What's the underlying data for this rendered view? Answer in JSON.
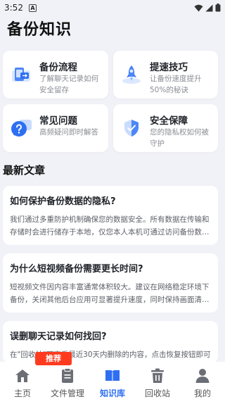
{
  "status": {
    "time": "3:52",
    "notification_icon": "A"
  },
  "page_title": "备份知识",
  "cards": [
    {
      "title": "备份流程",
      "desc": "了解聊天记录如何安全留存",
      "icon": "phone-backup-icon"
    },
    {
      "title": "提速技巧",
      "desc": "让备份速度提升50%的秘诀",
      "icon": "rocket-icon"
    },
    {
      "title": "常见问题",
      "desc": "高频疑问即时解答",
      "icon": "question-bubble-icon"
    },
    {
      "title": "安全保障",
      "desc": "您的隐私权如何被守护",
      "icon": "shield-icon"
    }
  ],
  "section_title": "最新文章",
  "articles": [
    {
      "title": "如何保护备份数据的隐私?",
      "body": "我们通过多重防护机制确保您的数据安全。所有数据在传输和存储时会进行储存于本地，仅您本人本机可通过访问备份数据。"
    },
    {
      "title": "为什么短视频备份需要更长时间?",
      "body": "短视频文件因内容丰富通常体积较大。建议在网络稳定环境下备份，关闭其他后台应用可显著提升速度，同时保持画面清晰。"
    },
    {
      "title": "误删聊天记录如何找回?",
      "body": "在\"回收站\"可查看最近30天内删除的内容，点击恢复按钮即可还原，超过期限的内容将被永久删除，请及时处理。提示：勿"
    }
  ],
  "recommend_badge": "推荐",
  "tabs": [
    {
      "label": "主页",
      "icon": "home-icon",
      "active": false
    },
    {
      "label": "文件管理",
      "icon": "file-icon",
      "active": false
    },
    {
      "label": "知识库",
      "icon": "book-icon",
      "active": true
    },
    {
      "label": "回收站",
      "icon": "trash-icon",
      "active": false
    },
    {
      "label": "我的",
      "icon": "person-icon",
      "active": false
    }
  ],
  "colors": {
    "accent": "#2e6ff2",
    "badge": "#ff3b1f",
    "background": "#f1f2f7"
  }
}
